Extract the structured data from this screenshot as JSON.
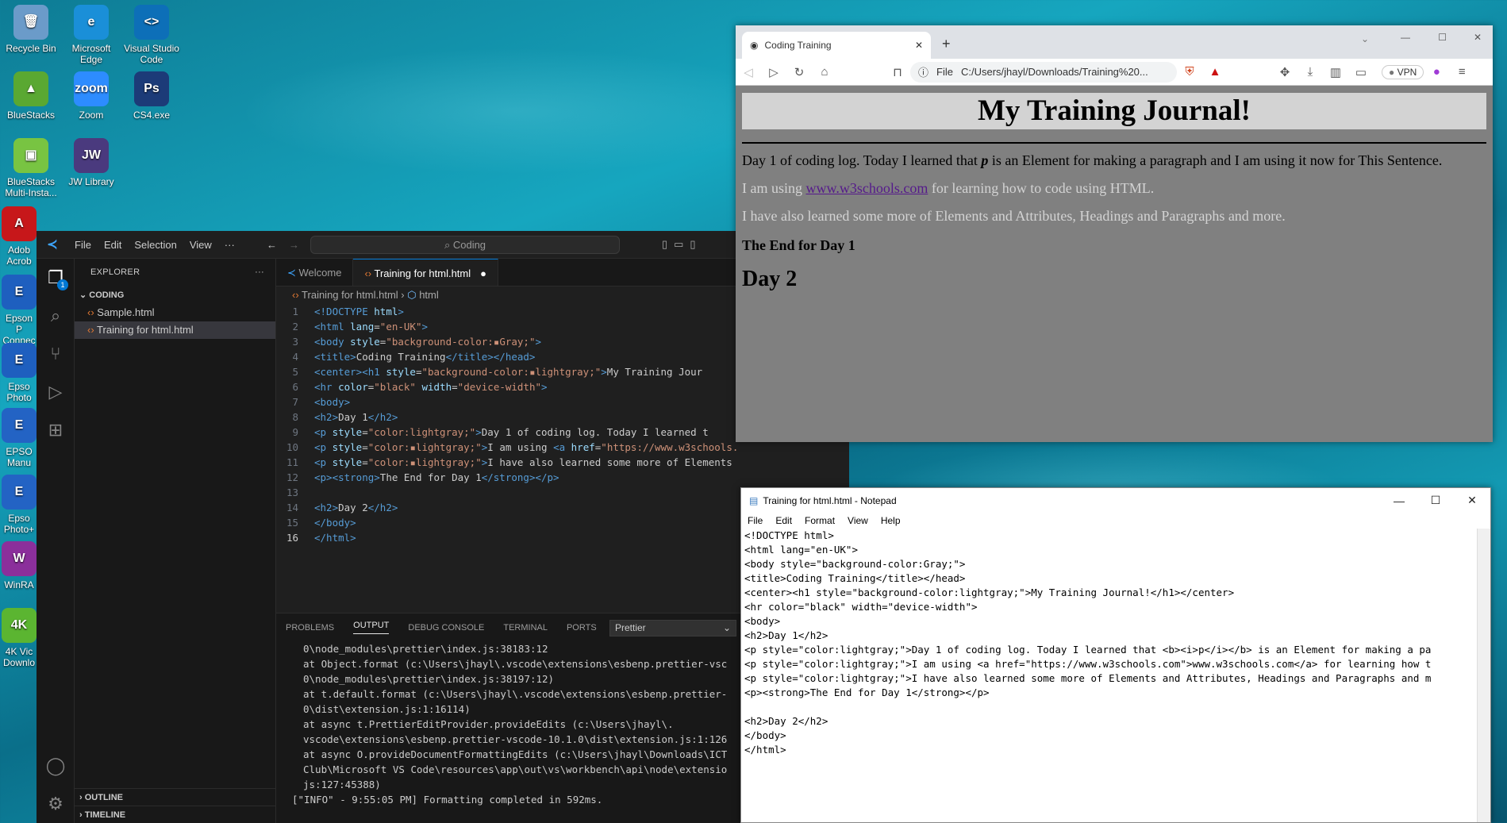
{
  "desktop": {
    "icons": [
      {
        "label": "Recycle Bin",
        "color": "#6b9bc9",
        "glyph": "🗑"
      },
      {
        "label": "Microsoft Edge",
        "color": "#1a8fd8",
        "glyph": "e"
      },
      {
        "label": "Visual Studio Code",
        "color": "#0d6fb8",
        "glyph": "<>"
      },
      {
        "label": "BlueStacks",
        "color": "#5aa832",
        "glyph": "▲"
      },
      {
        "label": "Zoom",
        "color": "#2d8cff",
        "glyph": "zoom"
      },
      {
        "label": "CS4.exe",
        "color": "#1c3b78",
        "glyph": "Ps"
      },
      {
        "label": "BlueStacks Multi-Insta...",
        "color": "#78c442",
        "glyph": "▣"
      },
      {
        "label": "JW Library",
        "color": "#4a3a7e",
        "glyph": "JW"
      },
      {
        "label": "Adob Acrob",
        "color": "#c7171a",
        "glyph": "A"
      },
      {
        "label": "Epson P Connec",
        "color": "#1e5fbf",
        "glyph": "E"
      },
      {
        "label": "Epso Photo",
        "color": "#1e5fbf",
        "glyph": "E"
      },
      {
        "label": "EPSO Manu",
        "color": "#2363c4",
        "glyph": "E"
      },
      {
        "label": "Epso Photo+",
        "color": "#2363c4",
        "glyph": "E"
      },
      {
        "label": "WinRA",
        "color": "#8b2f9b",
        "glyph": "W"
      },
      {
        "label": "4K Vic Downlo",
        "color": "#5bb531",
        "glyph": "4K"
      }
    ]
  },
  "vscode": {
    "menu": [
      "File",
      "Edit",
      "Selection",
      "View",
      "···"
    ],
    "search": "Coding",
    "explorer_title": "EXPLORER",
    "explorer_more": "···",
    "folder": "CODING",
    "files": [
      "Sample.html",
      "Training for html.html"
    ],
    "outline": "OUTLINE",
    "timeline": "TIMELINE",
    "badge": "1",
    "tabs": [
      "Welcome",
      "Training for html.html"
    ],
    "breadcrumb": [
      "Training for html.html",
      "html"
    ],
    "code_lines": [
      {
        "n": "1",
        "segs": [
          [
            "t-tag",
            "<!DOCTYPE "
          ],
          [
            "t-attr",
            "html"
          ],
          [
            "t-tag",
            ">"
          ]
        ]
      },
      {
        "n": "2",
        "segs": [
          [
            "t-tag",
            "<html "
          ],
          [
            "t-attr",
            "lang"
          ],
          [
            "t-txt",
            "="
          ],
          [
            "t-str",
            "\"en-UK\""
          ],
          [
            "t-tag",
            ">"
          ]
        ]
      },
      {
        "n": "3",
        "segs": [
          [
            "t-tag",
            "<body "
          ],
          [
            "t-attr",
            "style"
          ],
          [
            "t-txt",
            "="
          ],
          [
            "t-str",
            "\"background-color:▪Gray;\""
          ],
          [
            "t-tag",
            ">"
          ]
        ]
      },
      {
        "n": "4",
        "segs": [
          [
            "t-tag",
            "<title>"
          ],
          [
            "t-txt",
            "Coding Training"
          ],
          [
            "t-tag",
            "</title></head>"
          ]
        ]
      },
      {
        "n": "5",
        "segs": [
          [
            "t-tag",
            "<center><h1 "
          ],
          [
            "t-attr",
            "style"
          ],
          [
            "t-txt",
            "="
          ],
          [
            "t-str",
            "\"background-color:▪lightgray;\""
          ],
          [
            "t-tag",
            ">"
          ],
          [
            "t-txt",
            "My Training Jour"
          ]
        ]
      },
      {
        "n": "6",
        "segs": [
          [
            "t-tag",
            "<hr "
          ],
          [
            "t-attr",
            "color"
          ],
          [
            "t-txt",
            "="
          ],
          [
            "t-str",
            "\"black\" "
          ],
          [
            "t-attr",
            "width"
          ],
          [
            "t-txt",
            "="
          ],
          [
            "t-str",
            "\"device-width\""
          ],
          [
            "t-tag",
            ">"
          ]
        ]
      },
      {
        "n": "7",
        "segs": [
          [
            "t-tag",
            "<body>"
          ]
        ]
      },
      {
        "n": "8",
        "segs": [
          [
            "t-tag",
            "<h2>"
          ],
          [
            "t-txt",
            "Day 1"
          ],
          [
            "t-tag",
            "</h2>"
          ]
        ]
      },
      {
        "n": "9",
        "segs": [
          [
            "t-tag",
            "<p "
          ],
          [
            "t-attr",
            "style"
          ],
          [
            "t-txt",
            "="
          ],
          [
            "t-str",
            "\"color:lightgray;\""
          ],
          [
            "t-tag",
            ">"
          ],
          [
            "t-txt",
            "Day 1 of coding log. Today I learned t"
          ]
        ]
      },
      {
        "n": "10",
        "segs": [
          [
            "t-tag",
            "<p "
          ],
          [
            "t-attr",
            "style"
          ],
          [
            "t-txt",
            "="
          ],
          [
            "t-str",
            "\"color:▪lightgray;\""
          ],
          [
            "t-tag",
            ">"
          ],
          [
            "t-txt",
            "I am using "
          ],
          [
            "t-tag",
            "<a "
          ],
          [
            "t-attr",
            "href"
          ],
          [
            "t-txt",
            "="
          ],
          [
            "t-str",
            "\"https://www.w3schools."
          ]
        ]
      },
      {
        "n": "11",
        "segs": [
          [
            "t-tag",
            "<p "
          ],
          [
            "t-attr",
            "style"
          ],
          [
            "t-txt",
            "="
          ],
          [
            "t-str",
            "\"color:▪lightgray;\""
          ],
          [
            "t-tag",
            ">"
          ],
          [
            "t-txt",
            "I have also learned some more of Elements"
          ]
        ]
      },
      {
        "n": "12",
        "segs": [
          [
            "t-tag",
            "<p><strong>"
          ],
          [
            "t-txt",
            "The End for Day 1"
          ],
          [
            "t-tag",
            "</strong></p>"
          ]
        ]
      },
      {
        "n": "13",
        "segs": []
      },
      {
        "n": "14",
        "segs": [
          [
            "t-tag",
            "<h2>"
          ],
          [
            "t-txt",
            "Day 2"
          ],
          [
            "t-tag",
            "</h2>"
          ]
        ]
      },
      {
        "n": "15",
        "segs": [
          [
            "t-tag",
            "</body>"
          ]
        ]
      },
      {
        "n": "16",
        "segs": [
          [
            "t-tag",
            "</html>"
          ]
        ]
      }
    ],
    "panel_tabs": [
      "PROBLEMS",
      "OUTPUT",
      "DEBUG CONSOLE",
      "TERMINAL",
      "PORTS"
    ],
    "output_channel": "Prettier",
    "output_lines": [
      "0\\node_modules\\prettier\\index.js:38183:12",
      "at Object.format (c:\\Users\\jhayl\\.vscode\\extensions\\esbenp.prettier-vsc",
      "0\\node_modules\\prettier\\index.js:38197:12)",
      "at t.default.format (c:\\Users\\jhayl\\.vscode\\extensions\\esbenp.prettier-",
      "0\\dist\\extension.js:1:16114)",
      "at async t.PrettierEditProvider.provideEdits (c:\\Users\\jhayl\\.",
      "vscode\\extensions\\esbenp.prettier-vscode-10.1.0\\dist\\extension.js:1:126",
      "at async O.provideDocumentFormattingEdits (c:\\Users\\jhayl\\Downloads\\ICT",
      "Club\\Microsoft VS Code\\resources\\app\\out\\vs\\workbench\\api\\node\\extensio",
      "js:127:45388)",
      "[\"INFO\" - 9:55:05 PM] Formatting completed in 592ms."
    ]
  },
  "browser": {
    "tab_title": "Coding Training",
    "address_scheme": "File",
    "address": "C:/Users/jhayl/Downloads/Training%20...",
    "vpn": "VPN",
    "page": {
      "h1": "My Training Journal!",
      "p1_before": "Day 1 of coding log. Today I learned that ",
      "p1_em": "p",
      "p1_after": " is an Element for making a paragraph and I am using it now for This Sentence.",
      "p2_before": "I am using ",
      "p2_link": "www.w3schools.com",
      "p2_after": " for learning how to code using HTML.",
      "p3": "I have also learned some more of Elements and Attributes, Headings and Paragraphs and more.",
      "strong": "The End for Day 1",
      "h2": "Day 2"
    }
  },
  "notepad": {
    "title": "Training for html.html - Notepad",
    "menu": [
      "File",
      "Edit",
      "Format",
      "View",
      "Help"
    ],
    "lines": [
      "<!DOCTYPE html>",
      "<html lang=\"en-UK\">",
      "<body style=\"background-color:Gray;\">",
      "<title>Coding Training</title></head>",
      "<center><h1 style=\"background-color:lightgray;\">My Training Journal!</h1></center>",
      "<hr color=\"black\" width=\"device-width\">",
      "<body>",
      "<h2>Day 1</h2>",
      "<p style=\"color:lightgray;\">Day 1 of coding log. Today I learned that <b><i>p</i></b> is an Element for making a pa",
      "<p style=\"color:lightgray;\">I am using <a href=\"https://www.w3schools.com\">www.w3schools.com</a> for learning how t",
      "<p style=\"color:lightgray;\">I have also learned some more of Elements and Attributes, Headings and Paragraphs and m",
      "<p><strong>The End for Day 1</strong></p>",
      "",
      "<h2>Day 2</h2>",
      "</body>",
      "</html>"
    ]
  }
}
